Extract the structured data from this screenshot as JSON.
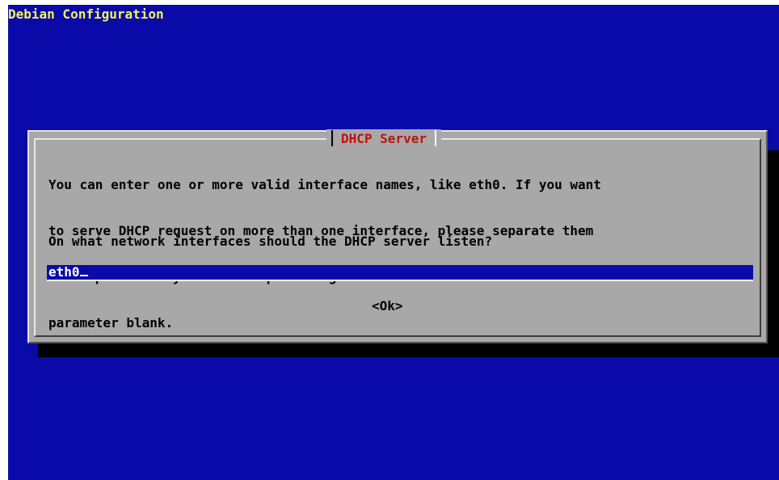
{
  "backtitle": "Debian Configuration",
  "dialog": {
    "title": "DHCP Server",
    "description_lines": [
      "You can enter one or more valid interface names, like eth0. If you want",
      "to serve DHCP request on more than one interface, please separate them",
      "with spaces. If you want dhcpd to figure out the interface leave this",
      "parameter blank."
    ],
    "question": "On what network interfaces should the DHCP server listen?",
    "input_value": "eth0",
    "ok_label": "<Ok>"
  },
  "colors": {
    "screen_background": "#0a0aa8",
    "dialog_background": "#a8a8a8",
    "backtitle_text": "#f4f45c",
    "title_text": "#c01010",
    "input_background": "#0a0aa8",
    "input_text": "#ffffff"
  }
}
